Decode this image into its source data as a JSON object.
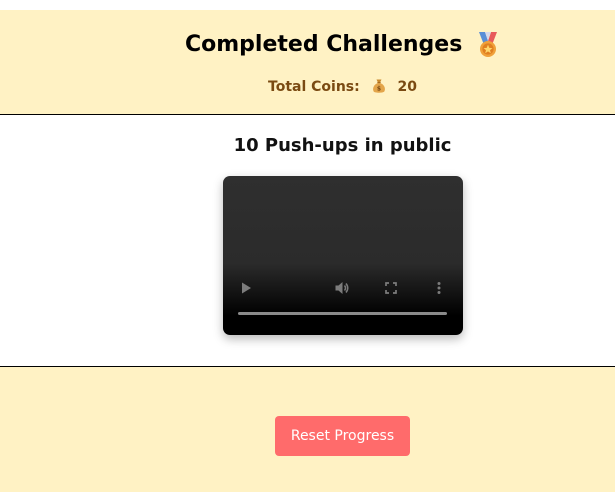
{
  "header": {
    "title": "Completed Challenges",
    "medal_icon": "medal-icon",
    "coins_label": "Total Coins:",
    "coins_icon": "money-bag-icon",
    "coins_value": "20"
  },
  "challenge": {
    "title": "10 Push-ups in public",
    "video": {
      "controls": [
        "play-icon",
        "volume-icon",
        "fullscreen-icon",
        "more-options-icon"
      ]
    }
  },
  "actions": {
    "reset_label": "Reset Progress"
  },
  "colors": {
    "background": "#fff2c4",
    "coins_text": "#7a4a12",
    "reset_button": "#ff6b6b",
    "video_bg": "#2f2f2f"
  }
}
